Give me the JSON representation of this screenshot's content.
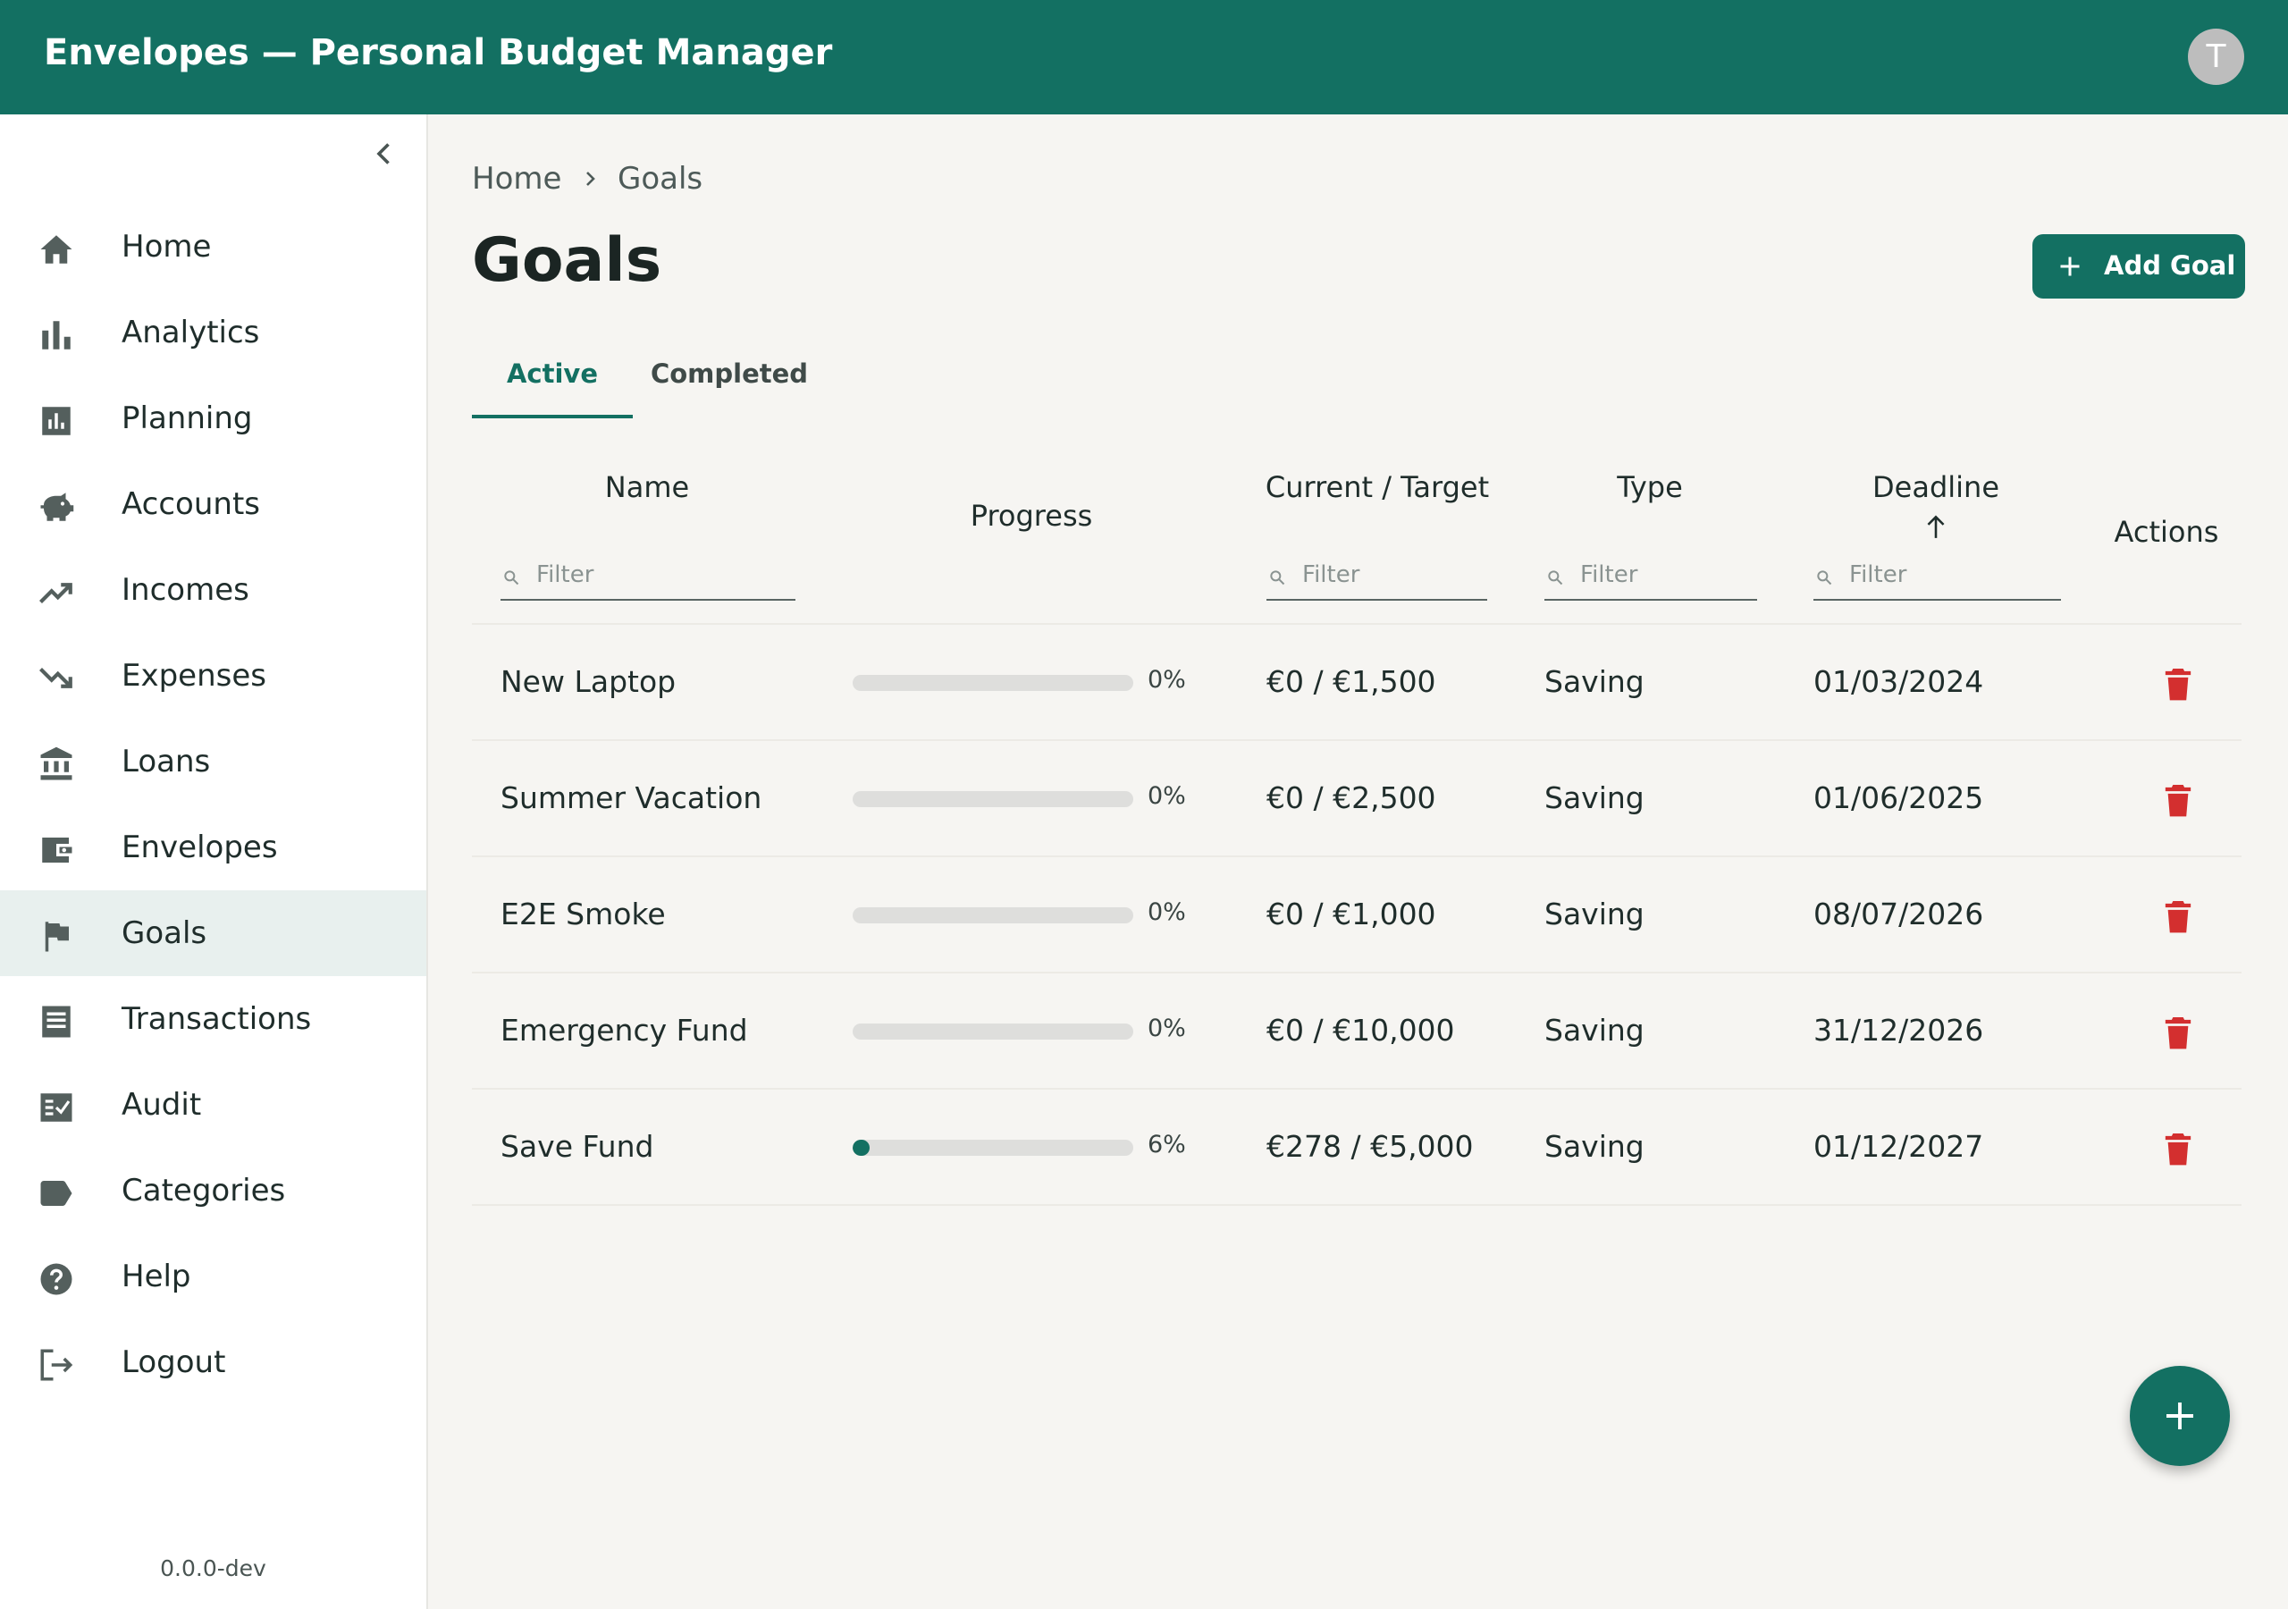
{
  "app": {
    "title": "Envelopes — Personal Budget Manager",
    "avatar_initial": "T"
  },
  "sidebar": {
    "items": [
      {
        "label": "Home",
        "icon": "home-icon",
        "active": false
      },
      {
        "label": "Analytics",
        "icon": "bar-chart-icon",
        "active": false
      },
      {
        "label": "Planning",
        "icon": "chart-box-icon",
        "active": false
      },
      {
        "label": "Accounts",
        "icon": "piggy-bank-icon",
        "active": false
      },
      {
        "label": "Incomes",
        "icon": "trending-up-icon",
        "active": false
      },
      {
        "label": "Expenses",
        "icon": "trending-down-icon",
        "active": false
      },
      {
        "label": "Loans",
        "icon": "bank-icon",
        "active": false
      },
      {
        "label": "Envelopes",
        "icon": "wallet-icon",
        "active": false
      },
      {
        "label": "Goals",
        "icon": "flag-icon",
        "active": true
      },
      {
        "label": "Transactions",
        "icon": "receipt-icon",
        "active": false
      },
      {
        "label": "Audit",
        "icon": "checklist-icon",
        "active": false
      },
      {
        "label": "Categories",
        "icon": "label-tag-icon",
        "active": false
      },
      {
        "label": "Help",
        "icon": "help-circle-icon",
        "active": false
      },
      {
        "label": "Logout",
        "icon": "logout-icon",
        "active": false
      }
    ],
    "version": "0.0.0-dev"
  },
  "breadcrumb": {
    "home": "Home",
    "current": "Goals"
  },
  "page": {
    "title": "Goals",
    "add_button": "Add Goal"
  },
  "tabs": [
    {
      "label": "Active",
      "active": true
    },
    {
      "label": "Completed",
      "active": false
    }
  ],
  "table": {
    "headers": {
      "name": "Name",
      "progress": "Progress",
      "current_target": "Current / Target",
      "type": "Type",
      "deadline": "Deadline",
      "actions": "Actions"
    },
    "filter_placeholder": "Filter",
    "sort": {
      "column": "Deadline",
      "direction": "ascending"
    },
    "rows": [
      {
        "name": "New Laptop",
        "progress": 0,
        "progress_label": "0%",
        "current_target": "€0 / €1,500",
        "type": "Saving",
        "deadline": "01/03/2024"
      },
      {
        "name": "Summer Vacation",
        "progress": 0,
        "progress_label": "0%",
        "current_target": "€0 / €2,500",
        "type": "Saving",
        "deadline": "01/06/2025"
      },
      {
        "name": "E2E Smoke",
        "progress": 0,
        "progress_label": "0%",
        "current_target": "€0 / €1,000",
        "type": "Saving",
        "deadline": "08/07/2026"
      },
      {
        "name": "Emergency Fund",
        "progress": 0,
        "progress_label": "0%",
        "current_target": "€0 / €10,000",
        "type": "Saving",
        "deadline": "31/12/2026"
      },
      {
        "name": "Save Fund",
        "progress": 6,
        "progress_label": "6%",
        "current_target": "€278 / €5,000",
        "type": "Saving",
        "deadline": "01/12/2027"
      }
    ]
  },
  "colors": {
    "primary": "#137062",
    "delete": "#d32f2f",
    "background": "#f6f5f2",
    "sidebar_active": "#e8f0ee"
  }
}
